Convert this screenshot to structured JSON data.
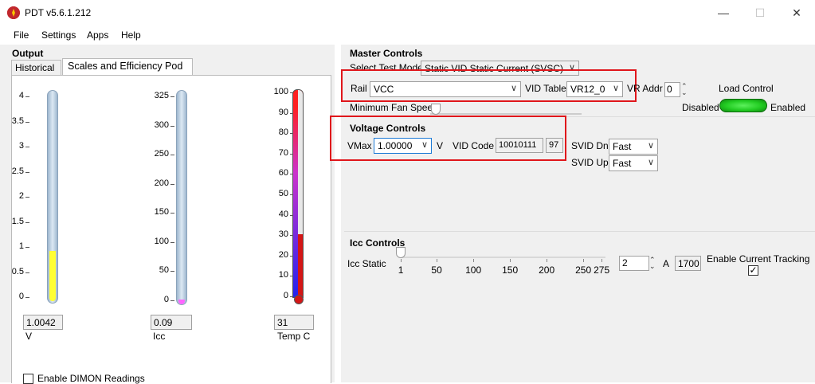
{
  "window": {
    "title": "PDT v5.6.1.212",
    "minimize": "—",
    "maximize": "☐",
    "close": "✕"
  },
  "menu": [
    "File",
    "Settings",
    "Apps",
    "Help"
  ],
  "output": {
    "title": "Output",
    "tabs": [
      "Historical",
      "Scales and Efficiency Pod"
    ],
    "voltage": {
      "ticks": [
        "4",
        "3.5",
        "3",
        "2.5",
        "2",
        "1.5",
        "1",
        "0.5",
        "0"
      ],
      "value": "1.0042",
      "unit": "V",
      "fill_color": "#ffff33",
      "max": 4,
      "level": 1.0042
    },
    "current": {
      "ticks": [
        "325",
        "300",
        "250",
        "200",
        "150",
        "100",
        "50",
        "0"
      ],
      "value": "0.09",
      "unit": "Icc",
      "fill_color": "#ff66ff",
      "max": 325,
      "level": 0.09
    },
    "temperature": {
      "ticks": [
        "100",
        "90",
        "80",
        "70",
        "60",
        "50",
        "40",
        "30",
        "20",
        "10",
        "0"
      ],
      "value": "31",
      "unit": "Temp C",
      "max": 100,
      "level": 31
    },
    "dimon_label": "Enable DIMON Readings"
  },
  "master": {
    "title": "Master Controls",
    "test_mode_label": "Select Test Mode",
    "test_mode_value": "Static VID Static Current  (SVSC)",
    "rail_label": "Rail",
    "rail_value": "VCC",
    "vid_table_label": "VID Table",
    "vid_table_value": "VR12_0",
    "vr_addr_label": "VR Addr",
    "vr_addr_value": "0",
    "load_control_label": "Load Control",
    "disabled_label": "Disabled",
    "enabled_label": "Enabled",
    "fan_label": "Minimum Fan Speed:"
  },
  "voltage_controls": {
    "title": "Voltage Controls",
    "vmax_label": "VMax",
    "vmax_value": "1.00000",
    "vmax_unit": "V",
    "vid_code_label": "VID Code",
    "vid_code_value": "10010111",
    "vid_code_hex": "97",
    "svid_dn_label": "SVID Dn",
    "svid_dn_value": "Fast",
    "svid_up_label": "SVID Up",
    "svid_up_value": "Fast"
  },
  "icc": {
    "title": "Icc Controls",
    "static_label": "Icc Static",
    "ticks": [
      "1",
      "50",
      "100",
      "150",
      "200",
      "250",
      "275"
    ],
    "value": "2",
    "unit": "A",
    "readout": "1700",
    "tracking_label": "Enable Current Tracking",
    "tracking_checked": "✓"
  },
  "colors": {
    "highlight": "#e0161b",
    "toggle": "#22cc22"
  }
}
